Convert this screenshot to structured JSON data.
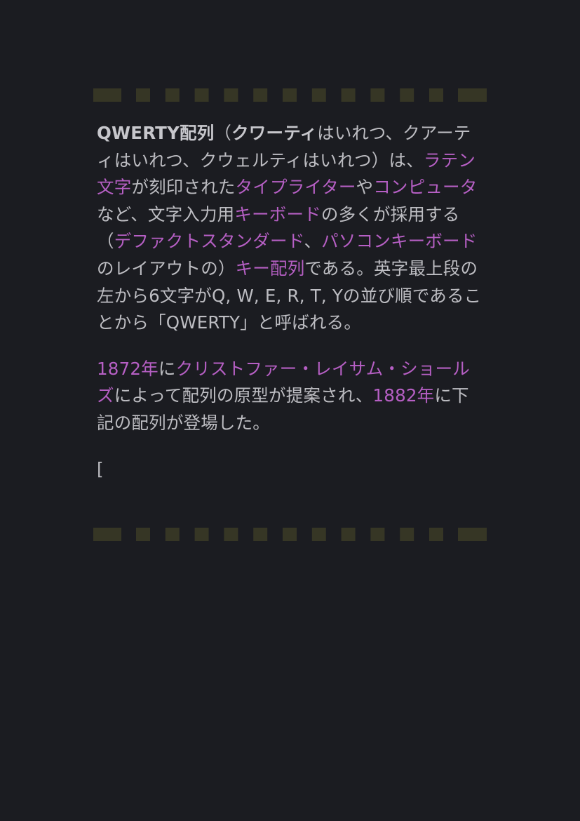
{
  "theme": {
    "background": "#1b1c21",
    "text_color": "#bdbdc2",
    "link_color": "#b65fc4",
    "border_color": "#363625"
  },
  "paragraphs": [
    [
      {
        "text": "QWERTY配列",
        "style": "bold"
      },
      {
        "text": "（",
        "style": "plain"
      },
      {
        "text": "クワーティ",
        "style": "bold"
      },
      {
        "text": "はいれつ、クアーティはいれつ、クウェルティはいれつ）は、",
        "style": "plain"
      },
      {
        "text": "ラテン文字",
        "style": "link"
      },
      {
        "text": "が刻印された",
        "style": "plain"
      },
      {
        "text": "タイプライター",
        "style": "link"
      },
      {
        "text": "や",
        "style": "plain"
      },
      {
        "text": "コンピュータ",
        "style": "link"
      },
      {
        "text": "など、文字入力用",
        "style": "plain"
      },
      {
        "text": "キーボード",
        "style": "link"
      },
      {
        "text": "の多くが採用する（",
        "style": "plain"
      },
      {
        "text": "デファクトスタンダード",
        "style": "link"
      },
      {
        "text": "、",
        "style": "plain"
      },
      {
        "text": "パソコンキーボード",
        "style": "link"
      },
      {
        "text": "のレイアウトの）",
        "style": "plain"
      },
      {
        "text": "キー配列",
        "style": "link"
      },
      {
        "text": "である。英字最上段の左から6文字がQ, W, E, R, T, Yの並び順であることから「QWERTY」と呼ばれる。",
        "style": "plain"
      }
    ],
    [
      {
        "text": "1872年",
        "style": "link"
      },
      {
        "text": "に",
        "style": "plain"
      },
      {
        "text": "クリストファー・レイサム・ショールズ",
        "style": "link"
      },
      {
        "text": "によって配列の原型が提案され、",
        "style": "plain"
      },
      {
        "text": "1882年",
        "style": "link"
      },
      {
        "text": "に下記の配列が登場した。",
        "style": "plain"
      }
    ],
    [
      {
        "text": "[",
        "style": "plain"
      }
    ]
  ]
}
